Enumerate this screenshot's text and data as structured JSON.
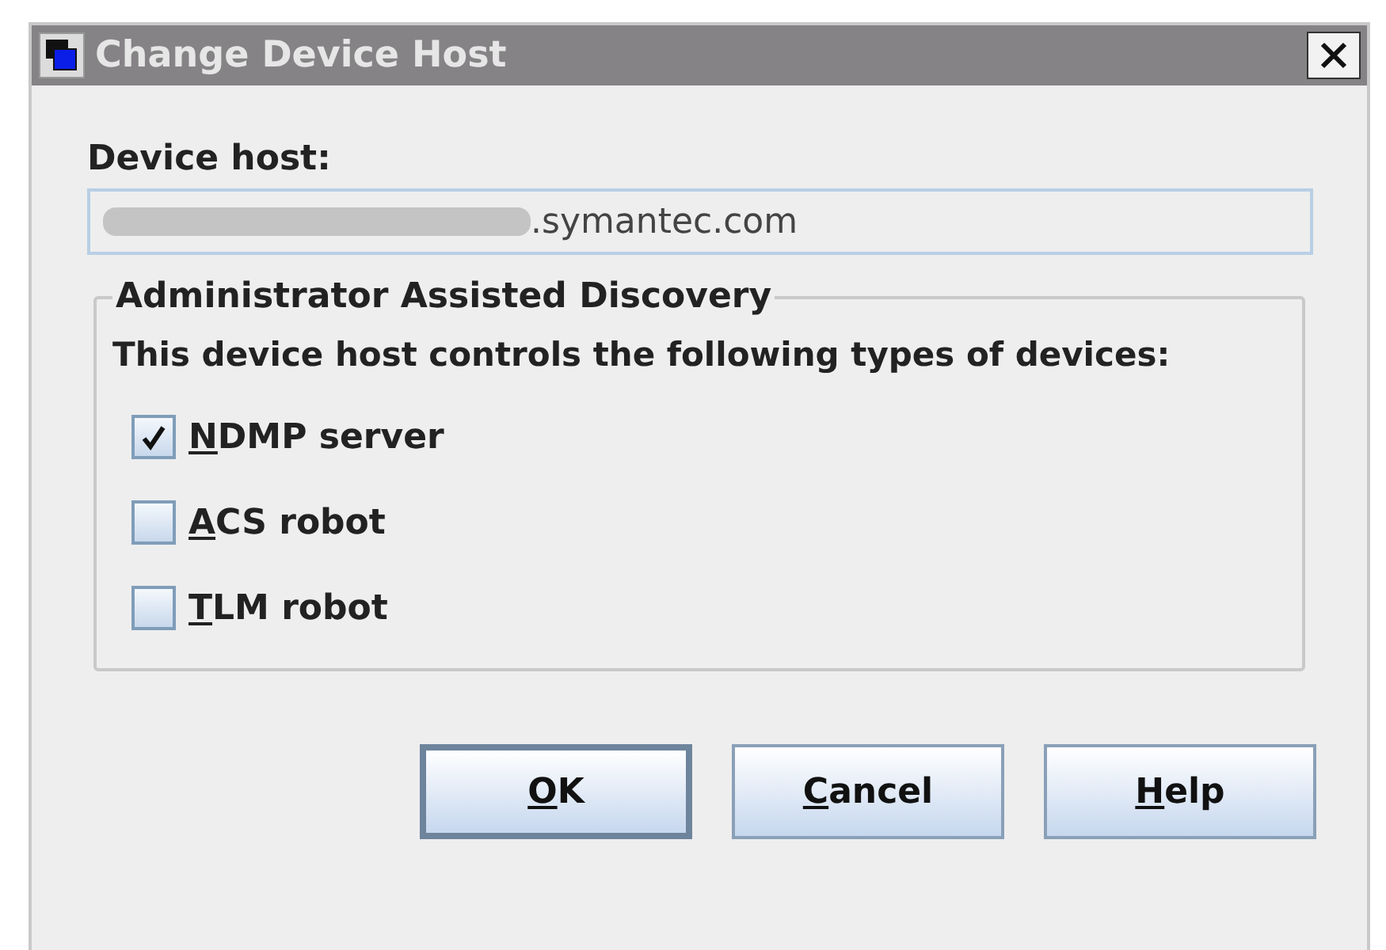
{
  "window": {
    "title": "Change Device Host"
  },
  "device_host": {
    "label": "Device host:",
    "value": ".symantec.com",
    "redacted": true
  },
  "group": {
    "title": "Administrator Assisted Discovery",
    "description": "This device host controls the following types of devices:",
    "options": [
      {
        "mnemonic": "N",
        "rest": "DMP server",
        "checked": true
      },
      {
        "mnemonic": "A",
        "rest": "CS robot",
        "checked": false
      },
      {
        "mnemonic": "T",
        "rest": "LM robot",
        "checked": false
      }
    ]
  },
  "buttons": [
    {
      "mnemonic": "O",
      "rest": "K",
      "default": true
    },
    {
      "mnemonic": "C",
      "rest": "ancel",
      "default": false
    },
    {
      "mnemonic": "H",
      "rest": "elp",
      "default": false
    }
  ]
}
